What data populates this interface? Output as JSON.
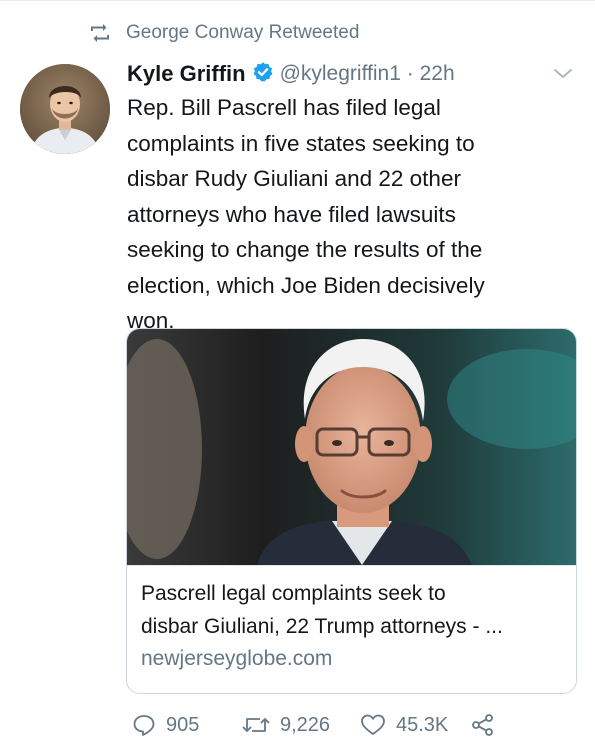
{
  "retweet_context": {
    "label": "George Conway Retweeted",
    "icon": "retweet-icon"
  },
  "author": {
    "name": "Kyle Griffin",
    "verified": true,
    "handle": "@kylegriffin1",
    "separator": "·",
    "time": "22h",
    "avatar_icon": "avatar"
  },
  "tweet": {
    "lines": [
      "Rep. Bill Pascrell has filed legal",
      "complaints in five states seeking to",
      "disbar Rudy Giuliani and 22 other",
      "attorneys who have filed lawsuits",
      "seeking to change the results of the",
      "election, which Joe Biden decisively",
      "won."
    ]
  },
  "link_card": {
    "title_lines": [
      "Pascrell legal complaints seek to",
      "disbar Giuliani, 22 Trump attorneys - ..."
    ],
    "domain": "newjerseyglobe.com",
    "image": "photo of elderly man with glasses"
  },
  "actions": {
    "reply_count": "905",
    "retweet_count": "9,226",
    "like_count": "45.3K"
  },
  "colors": {
    "text": "#14171a",
    "secondary": "#657786",
    "verified": "#1da1f2",
    "border": "#ccd6dd"
  }
}
